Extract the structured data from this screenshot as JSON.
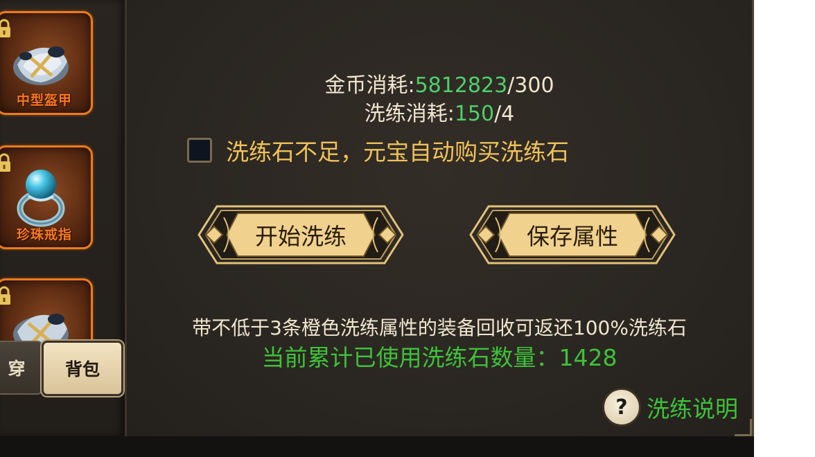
{
  "sidebar": {
    "items": [
      {
        "name": "中型盔甲",
        "icon": "armor-icon",
        "locked": true
      },
      {
        "name": "珍珠戒指",
        "icon": "pearl-ring-icon",
        "locked": true
      },
      {
        "name": "",
        "icon": "armor-icon",
        "locked": true
      }
    ],
    "tabs": [
      {
        "label": "穿",
        "active": false
      },
      {
        "label": "背包",
        "active": true
      }
    ]
  },
  "costs": {
    "gold_label": "金币消耗:",
    "gold_have": "5812823",
    "gold_need": "/300",
    "refine_label": "洗练消耗:",
    "refine_have": "150",
    "refine_need": "/4"
  },
  "auto_buy": {
    "checked": false,
    "label": "洗练石不足，元宝自动购买洗练石"
  },
  "buttons": {
    "start": "开始洗练",
    "save": "保存属性"
  },
  "note": "带不低于3条橙色洗练属性的装备回收可返还100%洗练石",
  "used_stones": "当前累计已使用洗练石数量：1428",
  "help": {
    "icon_text": "?",
    "label": "洗练说明"
  },
  "colors": {
    "highlight_green": "#4ed06a",
    "gold_text": "#f0c25a",
    "item_border": "#f07a1a"
  }
}
